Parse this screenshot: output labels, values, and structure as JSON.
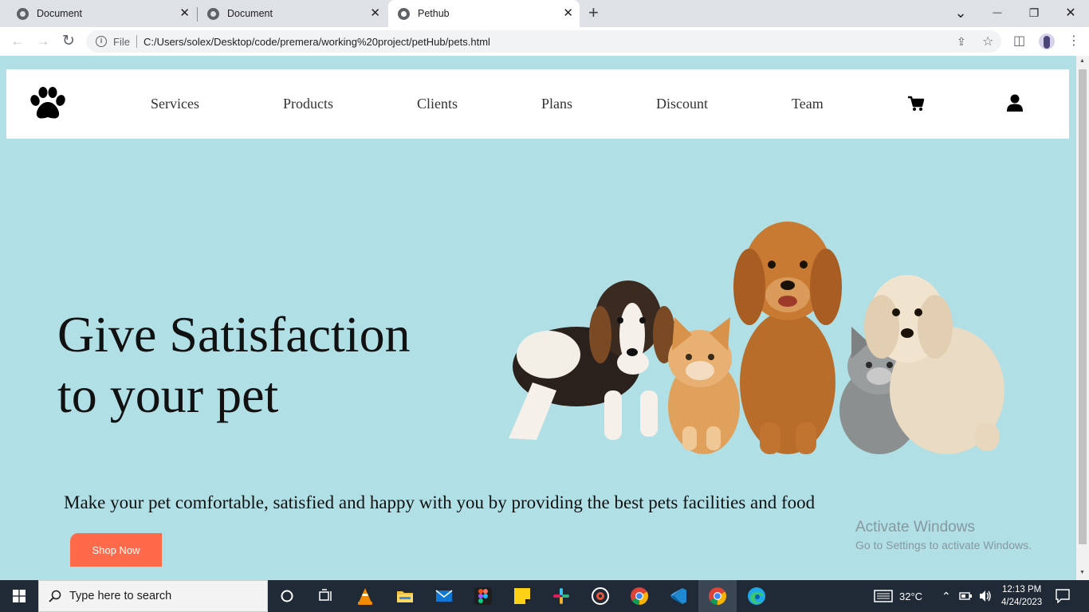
{
  "browser": {
    "tabs": [
      {
        "title": "Document",
        "active": false
      },
      {
        "title": "Document",
        "active": false
      },
      {
        "title": "Pethub",
        "active": true
      }
    ],
    "close_glyph": "✕",
    "new_tab_glyph": "+",
    "window_controls": {
      "collapse": "⌄",
      "minimize": "—",
      "restore": "❐",
      "close": "✕"
    },
    "nav": {
      "back": "←",
      "forward": "→",
      "reload": "↻"
    },
    "address": {
      "scheme_label": "File",
      "url": "C:/Users/solex/Desktop/code/premera/working%20project/petHub/pets.html"
    },
    "icons": {
      "share": "⇪",
      "star": "☆",
      "sidebar": "◫",
      "menu": "⋮"
    }
  },
  "page": {
    "brand_icon": "paw-icon",
    "nav_links": [
      "Services",
      "Products",
      "Clients",
      "Plans",
      "Discount",
      "Team"
    ],
    "hero": {
      "title_line1": "Give Satisfaction",
      "title_line2": "to your pet",
      "subtitle": "Make your pet comfortable, satisfied and happy with you by providing the best pets facilities and food",
      "cta": "Shop Now"
    },
    "watermark": {
      "line1": "Activate Windows",
      "line2": "Go to Settings to activate Windows."
    },
    "colors": {
      "background": "#b0dfe5",
      "navbar": "#ffffff",
      "cta": "#ff6b4a",
      "text": "#111111"
    }
  },
  "taskbar": {
    "search_placeholder": "Type here to search",
    "weather": "32°C",
    "time": "12:13 PM",
    "date": "4/24/2023",
    "apps": [
      "cortana-icon",
      "task-view-icon",
      "vlc-icon",
      "file-explorer-icon",
      "mail-icon",
      "figma-icon",
      "sticky-notes-icon",
      "slack-icon",
      "media-player-icon",
      "chrome-icon",
      "vscode-icon",
      "chrome-icon",
      "edge-icon"
    ]
  }
}
